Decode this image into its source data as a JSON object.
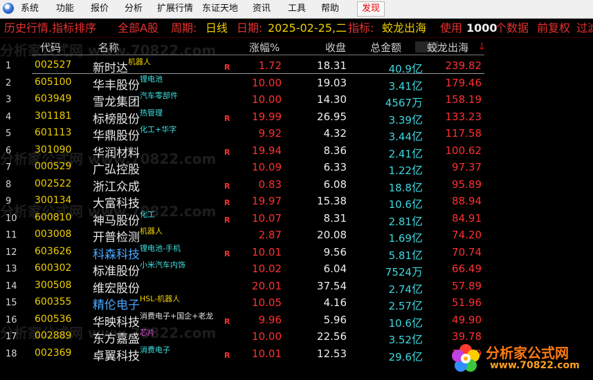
{
  "menu": {
    "items": [
      "系统",
      "功能",
      "报价",
      "分析",
      "扩展行情",
      "东证天地",
      "资讯",
      "工具",
      "帮助"
    ],
    "active": "发现"
  },
  "infobar": {
    "title": "历史行情.指标排序",
    "market": "全部A股",
    "period_label": "周期:",
    "period_value": "日线",
    "date_label": "日期:",
    "date_value": "2025-02-25,二",
    "indicator_label": "指标:",
    "indicator_value": "蛟龙出海",
    "use_label": "使用",
    "use_count": "1000",
    "use_suffix": "个数据",
    "adjust": "前复权",
    "tail": "过滤"
  },
  "table": {
    "headers": {
      "code": "代码",
      "name": "名称",
      "change": "涨幅%",
      "close": "收盘",
      "amount": "总金额",
      "signal": "蛟龙出海",
      "sort_arrow": "↓"
    },
    "rows": [
      {
        "idx": "1",
        "code": "002527",
        "name": "新时达",
        "tag": "机器人",
        "tag_color": "y",
        "r": "R",
        "change": "1.72",
        "close": "18.31",
        "amount": "40.9",
        "unit": "亿",
        "signal": "239.82"
      },
      {
        "idx": "2",
        "code": "605100",
        "name": "华丰股份",
        "tag": "锂电池",
        "tag_color": "c",
        "r": "",
        "change": "10.00",
        "close": "19.03",
        "amount": "3.41",
        "unit": "亿",
        "signal": "179.46"
      },
      {
        "idx": "3",
        "code": "603949",
        "name": "雪龙集团",
        "tag": "汽车零部件",
        "tag_color": "c",
        "r": "",
        "change": "10.00",
        "close": "14.30",
        "amount": "4567",
        "unit": "万",
        "signal": "158.19"
      },
      {
        "idx": "4",
        "code": "301181",
        "name": "标榜股份",
        "tag": "热管理",
        "tag_color": "c",
        "r": "R",
        "change": "19.99",
        "close": "26.95",
        "amount": "3.39",
        "unit": "亿",
        "signal": "133.23"
      },
      {
        "idx": "5",
        "code": "601113",
        "name": "华鼎股份",
        "tag": "化工+华字",
        "tag_color": "c",
        "r": "",
        "change": "9.92",
        "close": "4.32",
        "amount": "3.44",
        "unit": "亿",
        "signal": "117.58"
      },
      {
        "idx": "6",
        "code": "301090",
        "name": "华润材料",
        "tag": "",
        "tag_color": "",
        "r": "R",
        "change": "19.94",
        "close": "8.36",
        "amount": "2.41",
        "unit": "亿",
        "signal": "100.62"
      },
      {
        "idx": "7",
        "code": "000529",
        "name": "广弘控股",
        "tag": "",
        "tag_color": "",
        "r": "",
        "change": "10.09",
        "close": "6.33",
        "amount": "1.22",
        "unit": "亿",
        "signal": "97.37"
      },
      {
        "idx": "8",
        "code": "002522",
        "name": "浙江众成",
        "tag": "",
        "tag_color": "",
        "r": "R",
        "change": "0.83",
        "close": "6.08",
        "amount": "18.8",
        "unit": "亿",
        "signal": "95.89"
      },
      {
        "idx": "9",
        "code": "300134",
        "name": "大富科技",
        "tag": "",
        "tag_color": "",
        "r": "R",
        "change": "19.97",
        "close": "15.38",
        "amount": "10.6",
        "unit": "亿",
        "signal": "88.94"
      },
      {
        "idx": "10",
        "code": "600810",
        "name": "神马股份",
        "tag": "化工",
        "tag_color": "c",
        "r": "R",
        "change": "10.07",
        "close": "8.31",
        "amount": "2.81",
        "unit": "亿",
        "signal": "84.91"
      },
      {
        "idx": "11",
        "code": "003008",
        "name": "开普检测",
        "tag": "机器人",
        "tag_color": "y",
        "r": "",
        "change": "2.87",
        "close": "20.08",
        "amount": "1.69",
        "unit": "亿",
        "signal": "74.20"
      },
      {
        "idx": "12",
        "code": "603626",
        "name": "科森科技",
        "tag": "锂电池-手机",
        "tag_color": "c",
        "r": "R",
        "change": "10.01",
        "close": "9.56",
        "amount": "5.81",
        "unit": "亿",
        "signal": "70.74",
        "blue": true
      },
      {
        "idx": "13",
        "code": "600302",
        "name": "标准股份",
        "tag": "小米汽车内饰",
        "tag_color": "c",
        "r": "",
        "change": "10.02",
        "close": "6.04",
        "amount": "7524",
        "unit": "万",
        "signal": "66.49"
      },
      {
        "idx": "14",
        "code": "300508",
        "name": "维宏股份",
        "tag": "",
        "tag_color": "",
        "r": "",
        "change": "20.01",
        "close": "37.54",
        "amount": "2.74",
        "unit": "亿",
        "signal": "57.89"
      },
      {
        "idx": "15",
        "code": "600355",
        "name": "精伦电子",
        "tag": "HSL-机器人",
        "tag_color": "y",
        "r": "",
        "change": "10.05",
        "close": "4.16",
        "amount": "2.57",
        "unit": "亿",
        "signal": "51.96",
        "blue": true
      },
      {
        "idx": "16",
        "code": "600536",
        "name": "华映科技",
        "tag": "消费电子+国企+老龙",
        "tag_color": "w",
        "r": "R",
        "change": "9.96",
        "close": "5.96",
        "amount": "10.6",
        "unit": "亿",
        "signal": "49.90"
      },
      {
        "idx": "17",
        "code": "002889",
        "name": "东方嘉盛",
        "tag": "芯片",
        "tag_color": "m",
        "r": "",
        "change": "10.00",
        "close": "22.56",
        "amount": "3.52",
        "unit": "亿",
        "signal": "39.78"
      },
      {
        "idx": "18",
        "code": "002369",
        "name": "卓翼科技",
        "tag": "消费电子",
        "tag_color": "c",
        "r": "R",
        "change": "10.01",
        "close": "12.53",
        "amount": "29.6",
        "unit": "亿",
        "signal": "35.09"
      }
    ]
  },
  "logo": {
    "text": "分析家公式网",
    "url": "www.70822.com"
  },
  "colors": {
    "background": "#000000",
    "code": "#f0d000",
    "up": "#ff3030",
    "amount": "#3cd8e0",
    "menu_active": "#e00000"
  }
}
